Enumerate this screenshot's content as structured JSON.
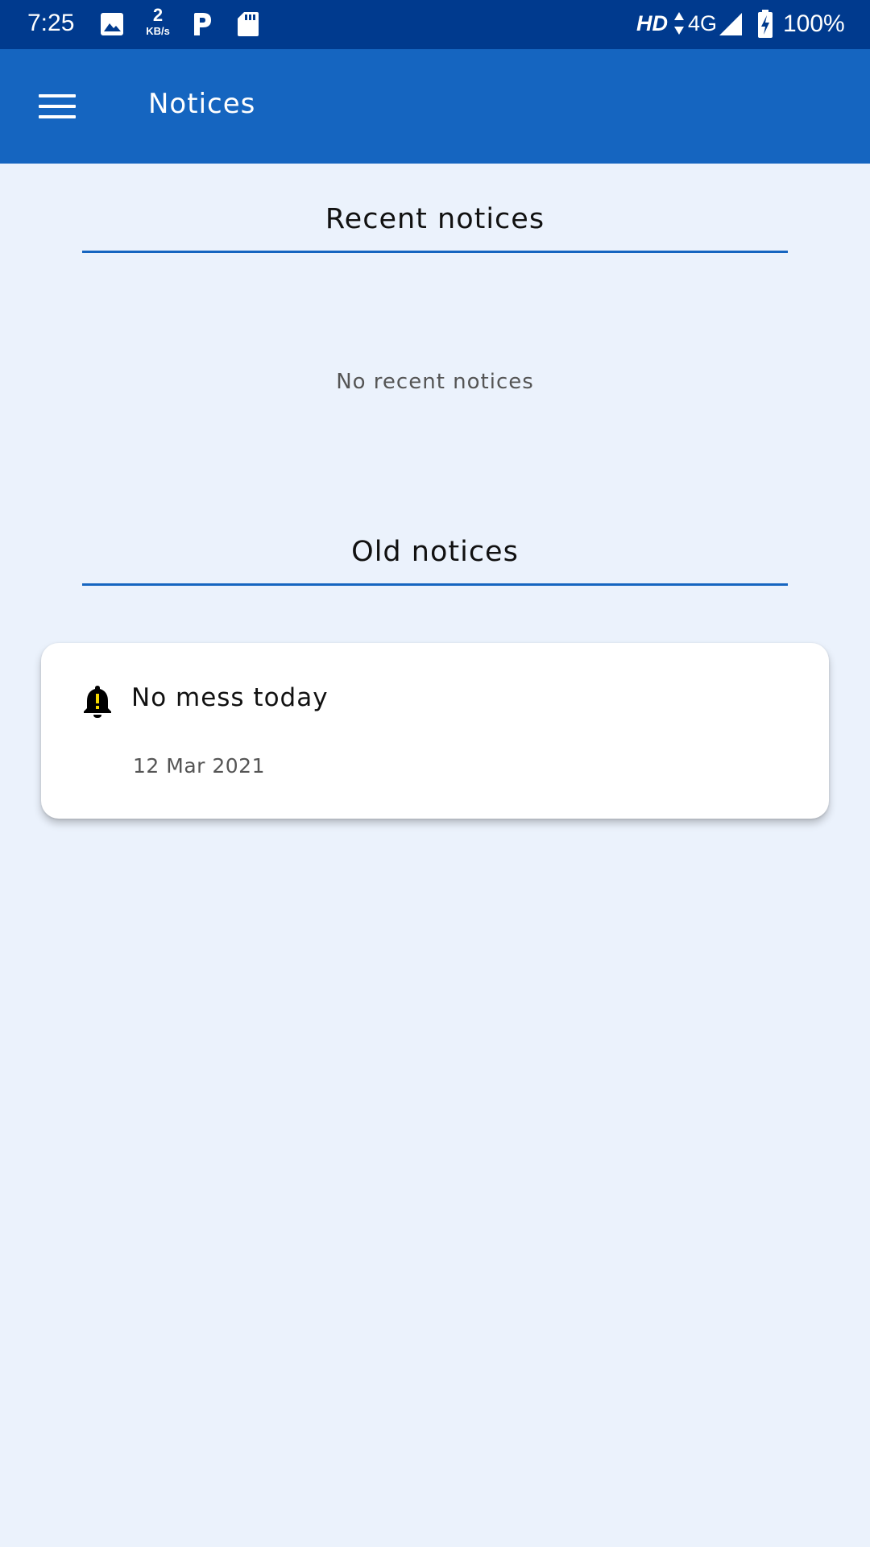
{
  "status_bar": {
    "time": "7:25",
    "net_speed_value": "2",
    "net_speed_unit": "KB/s",
    "hd_label": "HD",
    "network_label": "4G",
    "battery": "100%",
    "icons": [
      "image-icon",
      "parking-icon",
      "sd-card-icon",
      "data-arrows-icon",
      "signal-icon",
      "battery-charging-icon"
    ]
  },
  "app_bar": {
    "title": "Notices",
    "menu_icon": "menu-icon",
    "background": "#1565c0"
  },
  "recent": {
    "title": "Recent notices",
    "empty_text": "No recent notices"
  },
  "old": {
    "title": "Old notices",
    "items": [
      {
        "title": "No mess today",
        "date": "12 Mar 2021",
        "icon": "bell-alert-icon"
      }
    ]
  },
  "colors": {
    "status_bar": "#003a8e",
    "accent": "#1565c0",
    "page_background": "#ebf2fc",
    "bell_alert": "#f6d800"
  }
}
